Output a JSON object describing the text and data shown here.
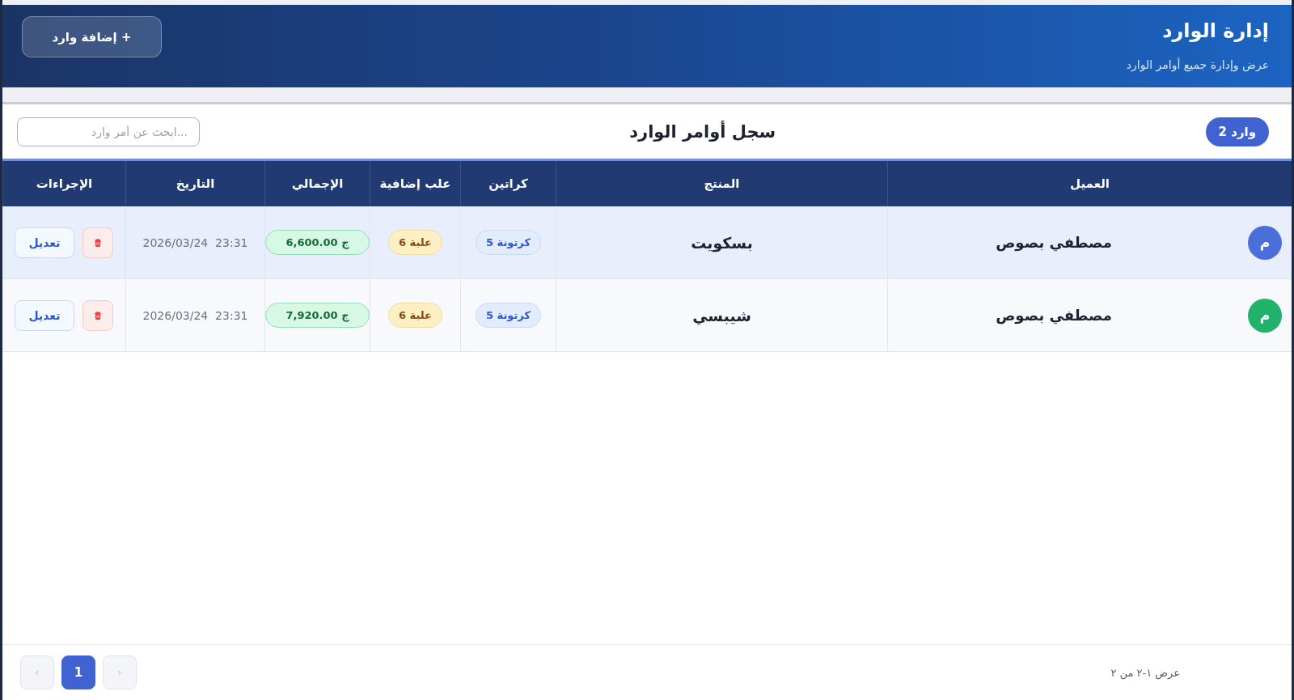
{
  "header": {
    "title": "إدارة الوارد",
    "subtitle": "عرض وإدارة جميع أوامر الوارد",
    "add_button": "+ إضافة وارد"
  },
  "card": {
    "count_badge": "وارد 2",
    "title": "سجل أوامر الوارد",
    "search": {
      "placeholder": "...ابحث عن أمر وارد"
    }
  },
  "table": {
    "columns": [
      "العميل",
      "المنتج",
      "كراتين",
      "علب إضافية",
      "الإجمالي",
      "التاريخ",
      "الإجراءات"
    ],
    "rows": [
      {
        "selected": true,
        "avatar": "م",
        "color": "#4a6fd8",
        "customer": "مصطفي بصوص",
        "product": "بسكويت",
        "cartons": "كرتونة 5",
        "extra": "علبة 6",
        "total": "ج 6,600.00",
        "date": "2026/03/24  23:31",
        "edit": "تعديل"
      },
      {
        "selected": false,
        "avatar": "م",
        "color": "#22b36b",
        "customer": "مصطفي بصوص",
        "product": "شيبسي",
        "cartons": "كرتونة 5",
        "extra": "علبة 6",
        "total": "ج 7,920.00",
        "date": "2026/03/24  23:31",
        "edit": "تعديل"
      }
    ]
  },
  "footer": {
    "summary": "عرض ١-٢ من ٢",
    "pages": [
      {
        "kind": "prev",
        "label": "‹",
        "selected": false,
        "disabled": true
      },
      {
        "kind": "page",
        "label": "1",
        "selected": true,
        "disabled": false
      },
      {
        "kind": "next",
        "label": "›",
        "selected": false,
        "disabled": true
      }
    ]
  }
}
